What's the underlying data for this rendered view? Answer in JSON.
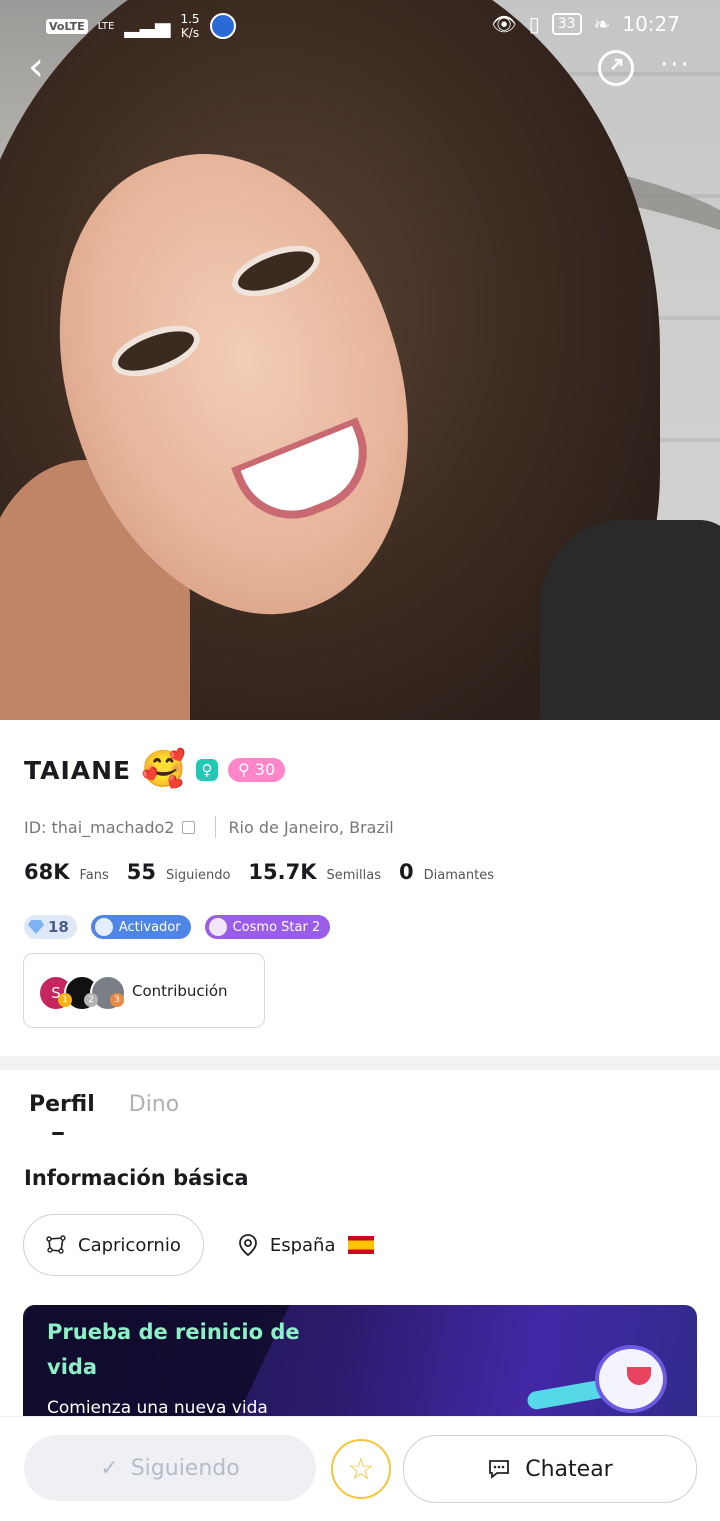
{
  "status_bar": {
    "volte": "VoLTE",
    "lte": "LTE",
    "speed_value": "1.5",
    "speed_unit": "K/s",
    "battery": "33",
    "time": "10:27"
  },
  "nav": {
    "back_icon": "chevron-left-icon",
    "share_icon": "share-icon",
    "more_icon": "more-icon"
  },
  "profile": {
    "name": "TAIANE",
    "emoji": "🥰",
    "level": "30",
    "id": "ID: thai_machado2",
    "location": "Rio de Janeiro, Brazil",
    "stats": [
      {
        "value": "68K",
        "label": "Fans"
      },
      {
        "value": "55",
        "label": "Siguiendo"
      },
      {
        "value": "15.7K",
        "label": "Semillas"
      },
      {
        "value": "0",
        "label": "Diamantes"
      }
    ],
    "badges": {
      "diamond_level": "18",
      "activator": "Activador",
      "cosmo": "Cosmo Star 2"
    },
    "contribution": {
      "label": "Contribución",
      "first_initial": "S",
      "ranks": [
        "1",
        "2",
        "3"
      ]
    }
  },
  "tabs": [
    {
      "label": "Perfil",
      "active": true
    },
    {
      "label": "Dino",
      "active": false
    }
  ],
  "basic_info": {
    "title": "Información básica",
    "sign": "Capricornio",
    "country": "España"
  },
  "banner": {
    "title": "Prueba de reinicio de vida",
    "subtitle": "Comienza una nueva vida"
  },
  "actions": {
    "following": "Siguiendo",
    "chat": "Chatear"
  },
  "colors": {
    "accent_teal": "#1fc9b4",
    "level_pink": "#ff86c8",
    "activator_blue": "#4f86e6",
    "cosmo_purple": "#9a5de8",
    "star_yellow": "#f3c63b"
  }
}
